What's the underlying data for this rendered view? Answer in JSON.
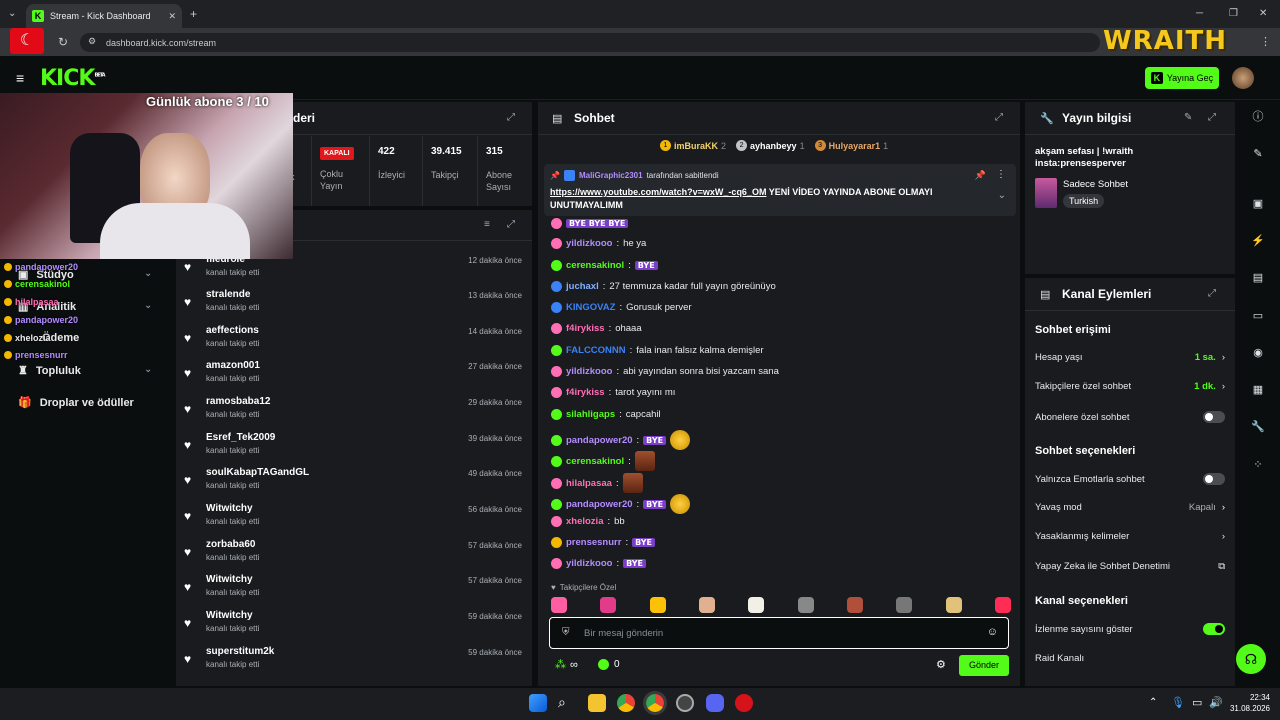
{
  "browser": {
    "tab_title": "Stream - Kick Dashboard",
    "url": "dashboard.kick.com/stream"
  },
  "header": {
    "logo": "KICK",
    "logo_beta": "BETA",
    "go_live_label": "Yayına Geç"
  },
  "overlay": {
    "daily_subs": "Günlük abone 3 / 10",
    "brand": "WRAITH",
    "messages": [
      {
        "user": "pandapower20",
        "color": "#b48cff"
      },
      {
        "user": "cerensakinol",
        "color": "#53fc18"
      },
      {
        "user": "hilalpasaa",
        "color": "#ff6fb5"
      },
      {
        "user": "pandapower20",
        "color": "#b48cff"
      },
      {
        "user": "xhelozia",
        "color": "#e8eaec"
      },
      {
        "user": "prensesnurr",
        "color": "#b48cff"
      }
    ]
  },
  "left_nav": {
    "items": [
      {
        "label": "Stüdyo"
      },
      {
        "label": "Analitik"
      },
      {
        "label": "Ödeme"
      },
      {
        "label": "Topluluk"
      },
      {
        "label": "Droplar ve ödüller"
      }
    ]
  },
  "stats_panel": {
    "title_fragment": "deri",
    "frag_k": "k",
    "multi_stream_badge": "KAPALI",
    "multi_stream_label": "Çoklu Yayın",
    "viewers": {
      "value": "422",
      "label": "İzleyici"
    },
    "followers": {
      "value": "39.415",
      "label": "Takipçi"
    },
    "subs": {
      "value": "315",
      "label": "Abone Sayısı"
    }
  },
  "followers_panel": {
    "rows": [
      {
        "name": "filedrole",
        "sub": "kanalı takip etti",
        "time": "12 dakika önce"
      },
      {
        "name": "stralende",
        "sub": "kanalı takip etti",
        "time": "13 dakika önce"
      },
      {
        "name": "aeffections",
        "sub": "kanalı takip etti",
        "time": "14 dakika önce"
      },
      {
        "name": "amazon001",
        "sub": "kanalı takip etti",
        "time": "27 dakika önce"
      },
      {
        "name": "ramosbaba12",
        "sub": "kanalı takip etti",
        "time": "29 dakika önce"
      },
      {
        "name": "Esref_Tek2009",
        "sub": "kanalı takip etti",
        "time": "39 dakika önce"
      },
      {
        "name": "soulKabapTAGandGL",
        "sub": "kanalı takip etti",
        "time": "49 dakika önce"
      },
      {
        "name": "Witwitchy",
        "sub": "kanalı takip etti",
        "time": "56 dakika önce"
      },
      {
        "name": "zorbaba60",
        "sub": "kanalı takip etti",
        "time": "57 dakika önce"
      },
      {
        "name": "Witwitchy",
        "sub": "kanalı takip etti",
        "time": "57 dakika önce"
      },
      {
        "name": "Witwitchy",
        "sub": "kanalı takip etti",
        "time": "59 dakika önce"
      },
      {
        "name": "superstitum2k",
        "sub": "kanalı takip etti",
        "time": "59 dakika önce"
      }
    ]
  },
  "chat": {
    "title": "Sohbet",
    "top_gifters": [
      {
        "rank": "1",
        "name": "imBuraKK",
        "count": "2"
      },
      {
        "rank": "2",
        "name": "ayhanbeyy",
        "count": "1"
      },
      {
        "rank": "3",
        "name": "Hulyayarar1",
        "count": "1"
      }
    ],
    "pinned": {
      "pinned_by_user": "MaliGraphic2301",
      "pinned_by_suffix": "tarafından sabitlendi",
      "link": "https://www.youtube.com/watch?v=wxW_-cq6_OM",
      "text_rest": " YENİ VİDEO YAYINDA ABONE OLMAYI UNUTMAYALIMM"
    },
    "messages": [
      {
        "user": "yildizkooo",
        "color": "#b48cff",
        "text": "he ya"
      },
      {
        "user": "cerensakinol",
        "color": "#53fc18",
        "text": "BYE"
      },
      {
        "user": "juchaxl",
        "color": "#7fb2ff",
        "text": "27 temmuza kadar full yayın göreünüyo"
      },
      {
        "user": "KINGOVAZ",
        "color": "#3b82f6",
        "text": "Gorusuk perver"
      },
      {
        "user": "f4irykiss",
        "color": "#ff6fb5",
        "text": "ohaaa"
      },
      {
        "user": "FALCCONNN",
        "color": "#3b82f6",
        "text": "fala inan falsız kalma demişler"
      },
      {
        "user": "yildizkooo",
        "color": "#b48cff",
        "text": "abi yayından sonra bisi yazcam sana"
      },
      {
        "user": "f4irykiss",
        "color": "#ff6fb5",
        "text": "tarot yayını mı"
      },
      {
        "user": "silahligaps",
        "color": "#53fc18",
        "text": "capcahil"
      },
      {
        "user": "pandapower20",
        "color": "#b48cff",
        "text": "BYE"
      },
      {
        "user": "cerensakinol",
        "color": "#53fc18",
        "text": ""
      },
      {
        "user": "hilalpasaa",
        "color": "#ff6fb5",
        "text": ""
      },
      {
        "user": "pandapower20",
        "color": "#b48cff",
        "text": "BYE"
      },
      {
        "user": "xhelozia",
        "color": "#ff6fb5",
        "text": "bb"
      },
      {
        "user": "prensesnurr",
        "color": "#b48cff",
        "text": "BYE"
      },
      {
        "user": "yildizkooo",
        "color": "#b48cff",
        "text": "BYE"
      }
    ],
    "first_msg_fragment_bye": "BYE BYE BYE",
    "followers_only_label": "Takipçilere Özel",
    "input_placeholder": "Bir mesaj gönderin",
    "infinity": "∞",
    "points": "0",
    "send_label": "Gönder"
  },
  "stream_info": {
    "title": "Yayın bilgisi",
    "stream_title": "akşam sefası | !wraith insta:prensesperver",
    "category": "Sadece Sohbet",
    "language_tag": "Turkish"
  },
  "channel_actions": {
    "title": "Kanal Eylemleri",
    "chat_access_heading": "Sohbet erişimi",
    "rows_access": [
      {
        "label": "Hesap yaşı",
        "value": "1 sa."
      },
      {
        "label": "Takipçilere özel sohbet",
        "value": "1 dk."
      },
      {
        "label": "Abonelere özel sohbet",
        "value": ""
      }
    ],
    "chat_options_heading": "Sohbet seçenekleri",
    "rows_options": [
      {
        "label": "Yalnızca Emotlarla sohbet",
        "value": ""
      },
      {
        "label": "Yavaş mod",
        "value": "Kapalı"
      },
      {
        "label": "Yasaklanmış kelimeler",
        "value": ""
      },
      {
        "label": "Yapay Zeka ile Sohbet Denetimi",
        "value": ""
      }
    ],
    "channel_options_heading": "Kanal seçenekleri",
    "rows_channel": [
      {
        "label": "İzlenme sayısını göster",
        "value": ""
      },
      {
        "label": "Raid Kanalı",
        "value": ""
      }
    ]
  },
  "taskbar": {
    "time": "22:34",
    "date": "31.08.2026"
  }
}
